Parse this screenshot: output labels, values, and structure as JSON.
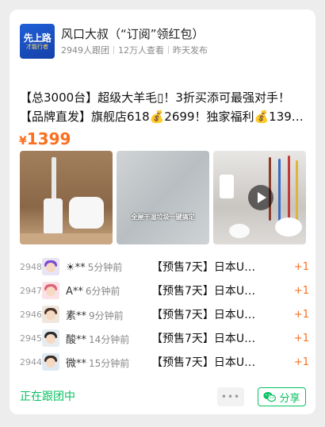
{
  "header": {
    "avatar_text_main": "先上路",
    "avatar_text_sub": "才能行者",
    "name": "风口大叔（“订阅”领红包）",
    "followers": "2949人跟团",
    "views": "12万人查看",
    "published": "昨天发布"
  },
  "post": {
    "title_line1": "【总3000台】超级大羊毛▯！3折买添可最强对手！",
    "title_line2": "【品牌直发】旗舰店618💰2699！独家福利💰1399…",
    "currency": "¥",
    "price": "1399",
    "image2_caption": "全屋干湿垃圾一键搞定"
  },
  "orders": [
    {
      "num": "2948",
      "user": "☀**",
      "time": "5分钟前",
      "item": "【预售7天】日本U…",
      "qty": "+1",
      "avatar_color": "#7a4bd1"
    },
    {
      "num": "2947",
      "user": "A**",
      "time": "6分钟前",
      "item": "【预售7天】日本U…",
      "qty": "+1",
      "avatar_color": "#e0607a"
    },
    {
      "num": "2946",
      "user": "素**",
      "time": "9分钟前",
      "item": "【预售7天】日本U…",
      "qty": "+1",
      "avatar_color": "#4a3528"
    },
    {
      "num": "2945",
      "user": "酸**",
      "time": "14分钟前",
      "item": "【预售7天】日本U…",
      "qty": "+1",
      "avatar_color": "#2b2b2b"
    },
    {
      "num": "2944",
      "user": "微**",
      "time": "15分钟前",
      "item": "【预售7天】日本U…",
      "qty": "+1",
      "avatar_color": "#3a2c22"
    }
  ],
  "footer": {
    "status": "正在跟团中",
    "more": "•••",
    "share": "分享"
  },
  "colors": {
    "accent": "#fa6f1e",
    "green": "#07c160"
  }
}
